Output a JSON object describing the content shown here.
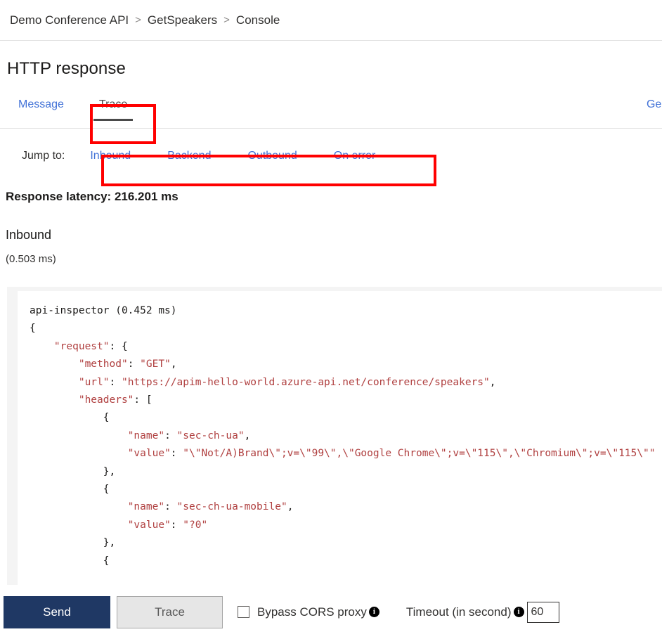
{
  "breadcrumb": {
    "items": [
      "Demo Conference API",
      "GetSpeakers",
      "Console"
    ],
    "separator": ">"
  },
  "page": {
    "title": "HTTP response"
  },
  "tabs": {
    "message_label": "Message",
    "trace_label": "Trace",
    "generate_link_label": "Generate d",
    "active": "Trace"
  },
  "jump_to": {
    "label": "Jump to:",
    "links": [
      "Inbound",
      "Backend",
      "Outbound",
      "On error"
    ]
  },
  "trace": {
    "latency_label": "Response latency: 216.201 ms",
    "section_name": "Inbound",
    "section_time": "(0.503 ms)"
  },
  "code": {
    "header": "api-inspector (0.452 ms)",
    "lines": [
      {
        "indent": 0,
        "plain": "api-inspector (0.452 ms)"
      },
      {
        "indent": 0,
        "plain": "{"
      },
      {
        "indent": 4,
        "key": "\"request\"",
        "plain_after": ": {"
      },
      {
        "indent": 8,
        "key": "\"method\"",
        "plain_after": ": ",
        "value": "\"GET\"",
        "plain_end": ","
      },
      {
        "indent": 8,
        "key": "\"url\"",
        "plain_after": ": ",
        "value": "\"https://apim-hello-world.azure-api.net/conference/speakers\"",
        "plain_end": ","
      },
      {
        "indent": 8,
        "key": "\"headers\"",
        "plain_after": ": ["
      },
      {
        "indent": 12,
        "plain": "{"
      },
      {
        "indent": 16,
        "key": "\"name\"",
        "plain_after": ": ",
        "value": "\"sec-ch-ua\"",
        "plain_end": ","
      },
      {
        "indent": 16,
        "key": "\"value\"",
        "plain_after": ": ",
        "value": "\"\\\"Not/A)Brand\\\";v=\\\"99\\\",\\\"Google Chrome\\\";v=\\\"115\\\",\\\"Chromium\\\";v=\\\"115\\\"\""
      },
      {
        "indent": 12,
        "plain": "},"
      },
      {
        "indent": 12,
        "plain": "{"
      },
      {
        "indent": 16,
        "key": "\"name\"",
        "plain_after": ": ",
        "value": "\"sec-ch-ua-mobile\"",
        "plain_end": ","
      },
      {
        "indent": 16,
        "key": "\"value\"",
        "plain_after": ": ",
        "value": "\"?0\""
      },
      {
        "indent": 12,
        "plain": "},"
      },
      {
        "indent": 12,
        "plain": "{"
      }
    ]
  },
  "toolbar": {
    "send_label": "Send",
    "trace_label": "Trace",
    "bypass_cors_label": "Bypass CORS proxy",
    "bypass_cors_checked": false,
    "bypass_info_glyph": "i",
    "timeout_label": "Timeout (in second)",
    "timeout_info_glyph": "i",
    "timeout_value": "60"
  },
  "annotations": {
    "color": "#ff0000",
    "boxes": [
      "trace-tab",
      "jump-to-links"
    ]
  }
}
